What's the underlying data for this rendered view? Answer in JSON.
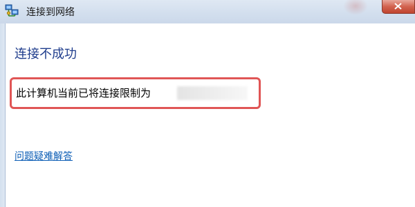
{
  "window": {
    "title": "连接到网络",
    "title_icon": "network-connection-icon",
    "close_icon": "close-icon"
  },
  "main": {
    "heading": "连接不成功",
    "message": "此计算机当前已将连接限制为",
    "help_link": "问题疑难解答"
  },
  "colors": {
    "heading": "#1e3c8c",
    "link": "#0b5db5",
    "highlight_border": "#e05555",
    "close_button": "#c9503b"
  }
}
